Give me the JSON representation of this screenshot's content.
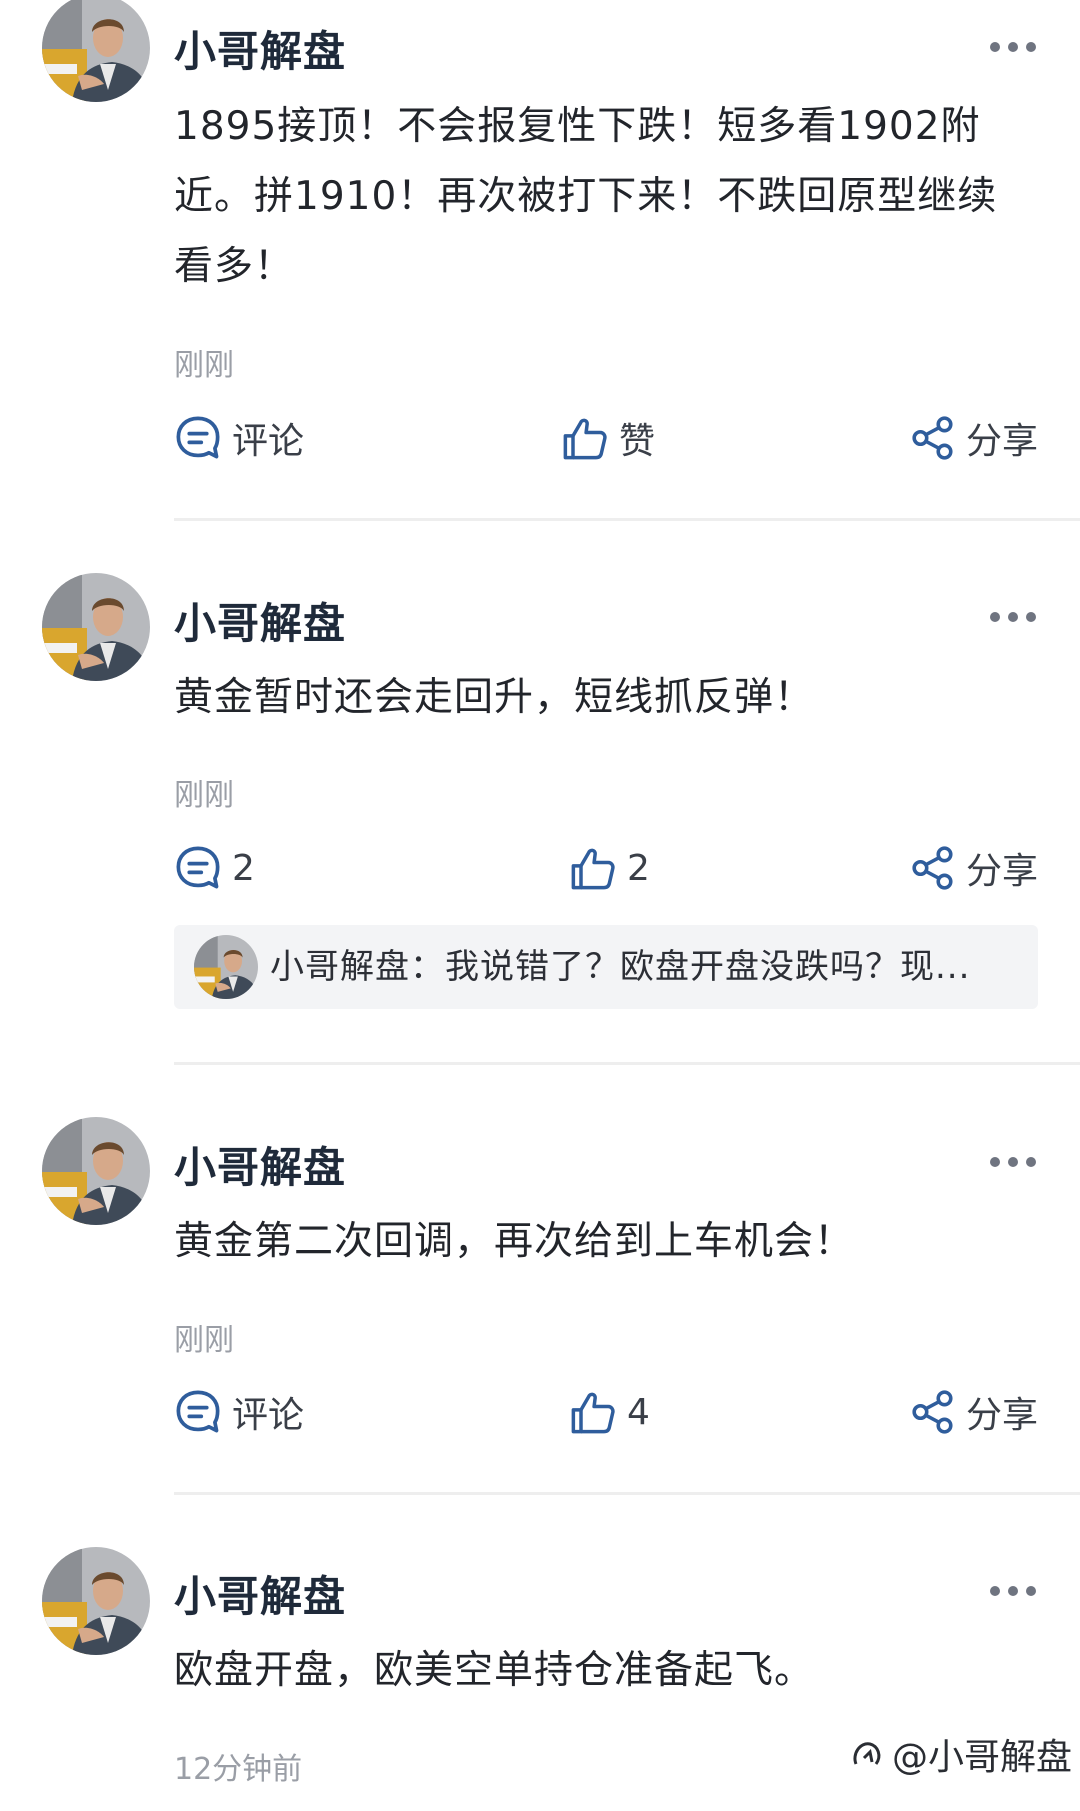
{
  "posts": [
    {
      "author": "小哥解盘",
      "content": "1895接顶！不会报复性下跌！短多看1902附近。拼1910！再次被打下来！不跌回原型继续看多！",
      "time": "刚刚",
      "comment_label": "评论",
      "like_label": "赞",
      "share_label": "分享"
    },
    {
      "author": "小哥解盘",
      "content": "黄金暂时还会走回升，短线抓反弹！",
      "time": "刚刚",
      "comment_label": "2",
      "like_label": "2",
      "share_label": "分享",
      "reply": "小哥解盘：我说错了？欧盘开盘没跌吗？现..."
    },
    {
      "author": "小哥解盘",
      "content": "黄金第二次回调，再次给到上车机会！",
      "time": "刚刚",
      "comment_label": "评论",
      "like_label": "4",
      "share_label": "分享"
    },
    {
      "author": "小哥解盘",
      "content": "欧盘开盘，欧美空单持仓准备起飞。",
      "time": "12分钟前"
    }
  ],
  "watermark": "@小哥解盘",
  "colors": {
    "icon": "#2f5d9c",
    "text_muted": "#9a9ea6"
  },
  "icons": [
    "comment-icon",
    "thumbs-up-icon",
    "share-icon",
    "more-icon"
  ]
}
